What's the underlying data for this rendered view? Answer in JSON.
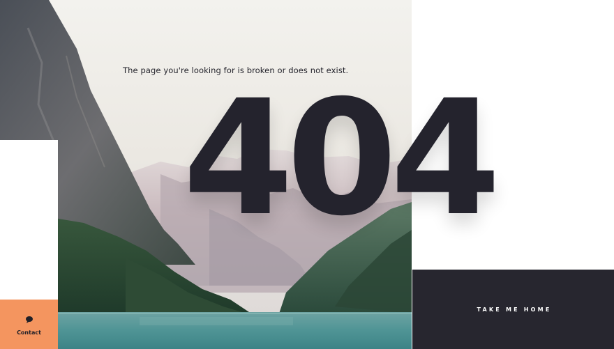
{
  "hero": {
    "message": "The page you're looking for is broken or does not exist.",
    "error_code": "404"
  },
  "cta": {
    "home_label": "TAKE ME HOME"
  },
  "contact": {
    "label": "Contact",
    "icon": "chat-bubble-icon"
  },
  "colors": {
    "dark": "#27262f",
    "accent": "#f4955f",
    "text": "#24232d",
    "white": "#ffffff"
  }
}
